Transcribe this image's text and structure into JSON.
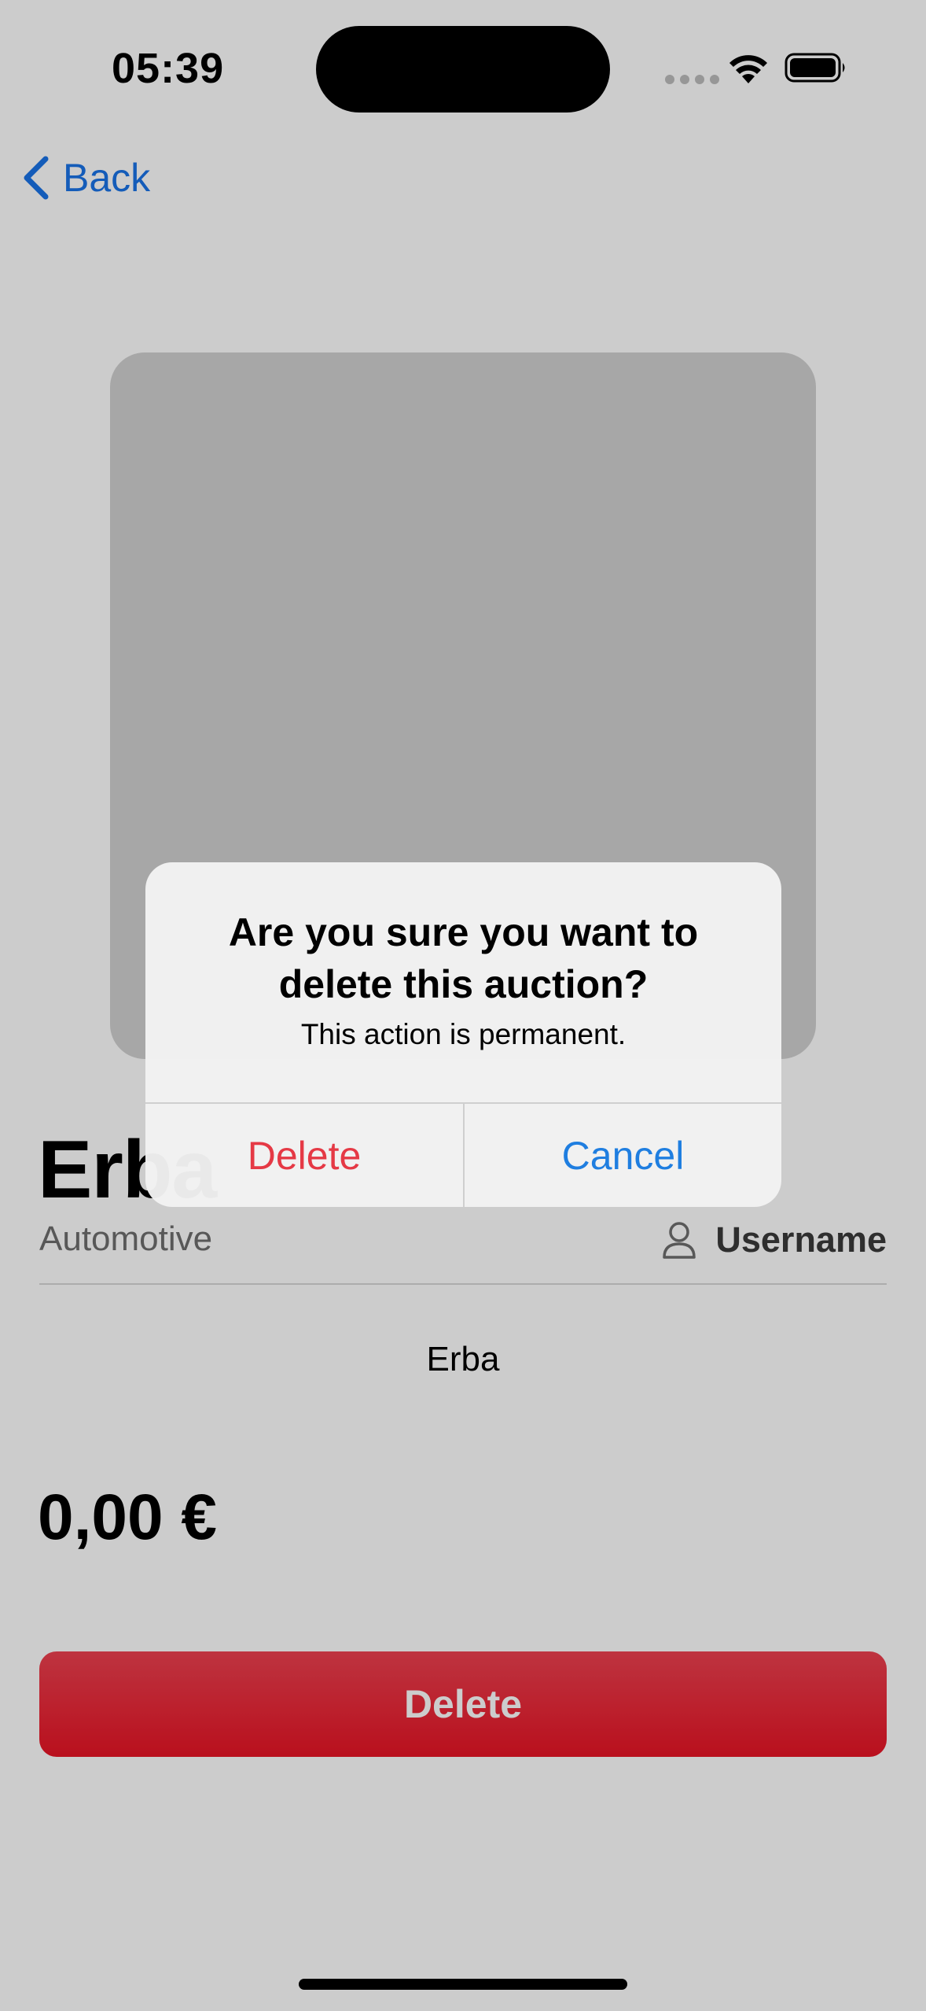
{
  "status_bar": {
    "time": "05:39"
  },
  "nav": {
    "back_label": "Back"
  },
  "auction": {
    "title": "Erba",
    "category": "Automotive",
    "seller": "Username",
    "description": "Erba",
    "price": "0,00 €",
    "delete_label": "Delete"
  },
  "alert": {
    "title": "Are you sure you want to delete this auction?",
    "message": "This action is permanent.",
    "delete_label": "Delete",
    "cancel_label": "Cancel"
  },
  "colors": {
    "destructive": "#e53945",
    "link": "#1f7ee0",
    "primary_button": "#e81425"
  },
  "icons": [
    "chevron-left-icon",
    "person-icon",
    "wifi-icon",
    "battery-icon"
  ]
}
